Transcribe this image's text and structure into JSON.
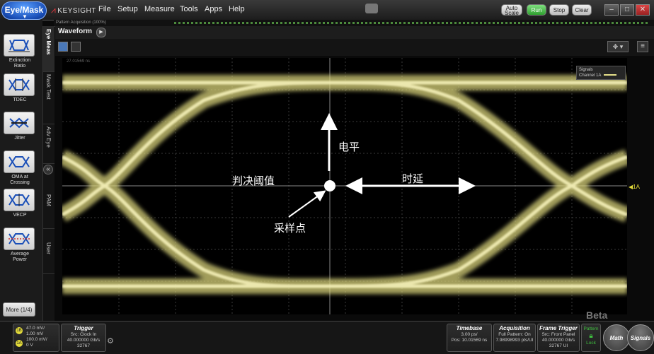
{
  "app": {
    "eye_mask_button": "Eye/Mask",
    "brand": "KEYSIGHT",
    "menu": [
      "File",
      "Setup",
      "Measure",
      "Tools",
      "Apps",
      "Help"
    ],
    "toolbar": {
      "auto_scale": "Auto Scale",
      "run": "Run",
      "stop": "Stop",
      "clear": "Clear"
    },
    "window_buttons": [
      "–",
      "□",
      "✕"
    ]
  },
  "status": {
    "label": "Pattern Acquisition (100%)"
  },
  "left_tools": [
    {
      "label": "Extinction Ratio",
      "icon": "extinction-ratio-icon"
    },
    {
      "label": "TDEC",
      "icon": "tdec-icon"
    },
    {
      "label": "Jitter",
      "icon": "jitter-icon"
    },
    {
      "label": "OMA at Crossing",
      "icon": "oma-icon"
    },
    {
      "label": "VECP",
      "icon": "vecp-icon"
    },
    {
      "label": "Average Power",
      "icon": "average-power-icon"
    }
  ],
  "more_button": "More (1/4)",
  "vertical_tabs": [
    "Eye Meas",
    "Mask Test",
    "Adv Eye",
    "PAM",
    "User"
  ],
  "waveform": {
    "tab": "Waveform",
    "corner_text": "27.01569 ns"
  },
  "legend": {
    "title": "Signals",
    "entry": "Channel 1A"
  },
  "channel_marker": "◀1A",
  "annotations": {
    "level": "电平",
    "threshold": "判决阈值",
    "delay": "时延",
    "sampling_point": "采样点"
  },
  "watermark": "Beta",
  "bottom": {
    "channel": {
      "badge_1": "1B",
      "line1": "47.0 mV/",
      "line2": "1.00 mV",
      "badge_2": "1A",
      "line3": "100.0 mV/",
      "line4": "0 V"
    },
    "trigger": {
      "title": "Trigger",
      "line1": "Src: Clock In",
      "line2": "40.000000 Gb/s",
      "line3": "32767"
    },
    "timebase": {
      "title": "Timebase",
      "line1": "3.00 ps/",
      "line2": "Pos: 10.01569 ns"
    },
    "acquisition": {
      "title": "Acquisition",
      "line1": "Full Pattern: On",
      "line2": "7.98998993 pts/UI"
    },
    "frame_trigger": {
      "title": "Frame Trigger",
      "line1": "Src: Front Panel",
      "line2": "40.000000 Gb/s",
      "line3": "32767 UI"
    },
    "pattern_lock": {
      "line1": "Pattern",
      "line2": "Lock"
    },
    "math": "Math",
    "signals": "Signals"
  },
  "colors": {
    "trace": "#e6e08a",
    "accent_blue": "#1a4fb8",
    "run_green": "#3fbf3f"
  }
}
